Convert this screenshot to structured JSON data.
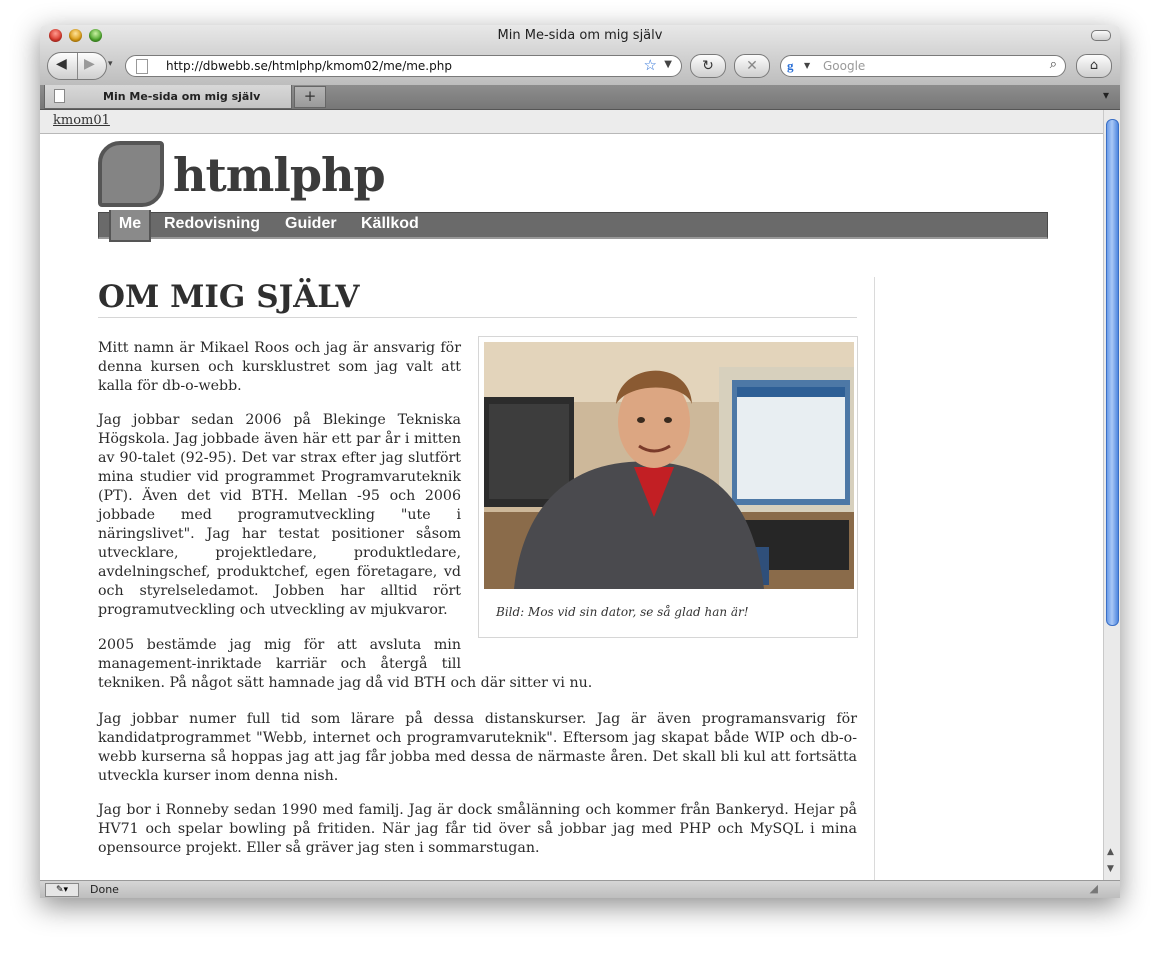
{
  "window": {
    "title": "Min Me-sida om mig själv"
  },
  "toolbar": {
    "url": "http://dbwebb.se/htmlphp/kmom02/me/me.php",
    "search_placeholder": "Google",
    "back_label": "◀",
    "forward_label": "▶",
    "history_label": "▾",
    "reload_label": "↻",
    "stop_label": "✕",
    "home_label": "⌂"
  },
  "tabs": [
    {
      "label": "Min Me-sida om mig själv"
    }
  ],
  "new_tab_label": "+",
  "bookmarks": [
    {
      "label": "kmom01"
    }
  ],
  "site": {
    "logo_text": "htmlphp",
    "nav": [
      {
        "label": "Me",
        "active": true
      },
      {
        "label": "Redovisning",
        "active": false
      },
      {
        "label": "Guider",
        "active": false
      },
      {
        "label": "Källkod",
        "active": false
      }
    ]
  },
  "article": {
    "heading": "OM MIG SJÄLV",
    "figure_caption": "Bild: Mos vid sin dator, se så glad han är!",
    "paragraphs": [
      "Mitt namn är Mikael Roos och jag är ansvarig för denna kursen och kursklustret som jag valt att kalla för db-o-webb.",
      "Jag jobbar sedan 2006 på Blekinge Tekniska Högskola. Jag jobbade även här ett par år i mitten av 90-talet (92-95). Det var strax efter jag slutfört mina studier vid programmet Programvaruteknik (PT). Även det vid BTH. Mellan -95 och 2006 jobbade med programutveckling \"ute i näringslivet\". Jag har testat positioner såsom utvecklare, projektledare, produktledare, avdelningschef, produktchef, egen företagare, vd och styrelseledamot. Jobben har alltid rört programutveckling och utveckling av mjukvaror.",
      "2005 bestämde jag mig för att avsluta min management-inriktade karriär och återgå till tekniken. På något sätt hamnade jag då vid BTH och där sitter vi nu.",
      "Jag jobbar numer full tid som lärare på dessa distanskurser. Jag är även programansvarig för kandidatprogrammet \"Webb, internet och programvaruteknik\". Eftersom jag skapat både WIP och db-o-webb kurserna så hoppas jag att jag får jobba med dessa de närmaste åren. Det skall bli kul att fortsätta utveckla kurser inom denna nish.",
      "Jag bor i Ronneby sedan 1990 med familj. Jag är dock smålänning och kommer från Bankeryd. Hejar på HV71 och spelar bowling på fritiden. När jag får tid över så jobbar jag med PHP och MySQL i mina opensource projekt. Eller så gräver jag sten i sommarstugan."
    ]
  },
  "status": {
    "text": "Done"
  },
  "colors": {
    "nav_bg": "#6a6a6a",
    "nav_active": "#8a8a8a",
    "logo": "#3b3b3b",
    "scroll_thumb": "#6b9ce8"
  }
}
